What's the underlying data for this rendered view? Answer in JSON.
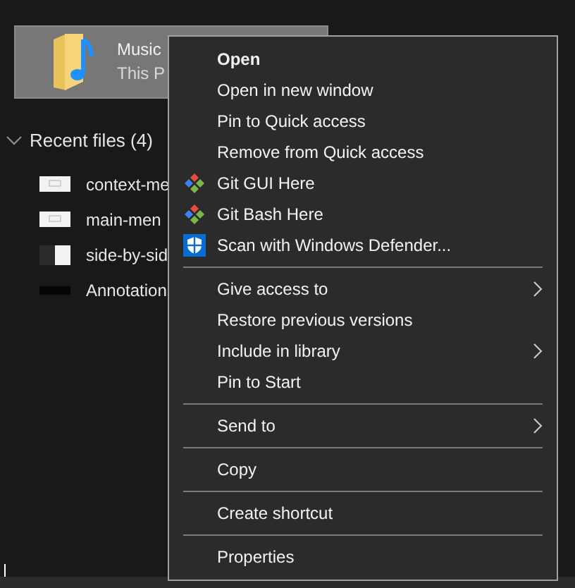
{
  "folder": {
    "name": "Music",
    "location": "This P",
    "selected": true
  },
  "recent": {
    "title": "Recent files (4)",
    "expanded": true,
    "files": [
      {
        "name": "context-me"
      },
      {
        "name": "main-men"
      },
      {
        "name": "side-by-sid"
      },
      {
        "name": "Annotation"
      }
    ]
  },
  "context_menu": [
    {
      "kind": "item",
      "label": "Open",
      "default": true,
      "submenu": false
    },
    {
      "kind": "item",
      "label": "Open in new window",
      "default": false,
      "submenu": false
    },
    {
      "kind": "item",
      "label": "Pin to Quick access",
      "default": false,
      "submenu": false
    },
    {
      "kind": "item",
      "label": "Remove from Quick access",
      "default": false,
      "submenu": false
    },
    {
      "kind": "item",
      "label": "Git GUI Here",
      "default": false,
      "submenu": false
    },
    {
      "kind": "item",
      "label": "Git Bash Here",
      "default": false,
      "submenu": false
    },
    {
      "kind": "item",
      "label": "Scan with Windows Defender...",
      "default": false,
      "submenu": false
    },
    {
      "kind": "separator"
    },
    {
      "kind": "item",
      "label": "Give access to",
      "default": false,
      "submenu": true
    },
    {
      "kind": "item",
      "label": "Restore previous versions",
      "default": false,
      "submenu": false
    },
    {
      "kind": "item",
      "label": "Include in library",
      "default": false,
      "submenu": true
    },
    {
      "kind": "item",
      "label": "Pin to Start",
      "default": false,
      "submenu": false
    },
    {
      "kind": "separator"
    },
    {
      "kind": "item",
      "label": "Send to",
      "default": false,
      "submenu": true
    },
    {
      "kind": "separator"
    },
    {
      "kind": "item",
      "label": "Copy",
      "default": false,
      "submenu": false
    },
    {
      "kind": "separator"
    },
    {
      "kind": "item",
      "label": "Create shortcut",
      "default": false,
      "submenu": false
    },
    {
      "kind": "separator"
    },
    {
      "kind": "item",
      "label": "Properties",
      "default": false,
      "submenu": false
    }
  ]
}
